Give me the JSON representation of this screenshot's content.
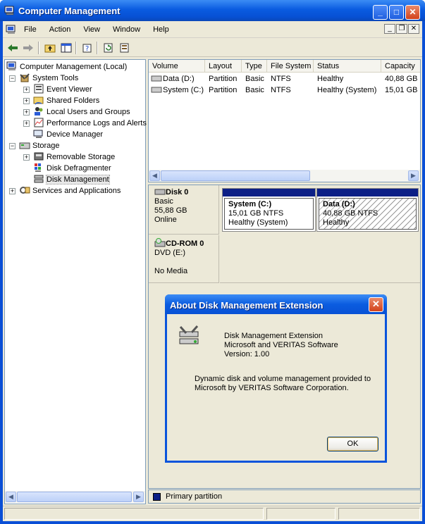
{
  "window": {
    "title": "Computer Management",
    "icon": "computer-management-icon"
  },
  "menu": {
    "items": [
      "File",
      "Action",
      "View",
      "Window",
      "Help"
    ]
  },
  "toolbar": {
    "buttons": [
      "back-arrow-icon",
      "forward-arrow-icon",
      "up-folder-icon",
      "show-hide-tree-icon",
      "help-icon",
      "refresh-icon",
      "properties-icon"
    ]
  },
  "tree": {
    "items": [
      {
        "label": "Computer Management (Local)",
        "icon": "computer-icon"
      },
      {
        "label": "System Tools",
        "icon": "tools-icon"
      },
      {
        "label": "Event Viewer",
        "icon": "event-viewer-icon"
      },
      {
        "label": "Shared Folders",
        "icon": "shared-folders-icon"
      },
      {
        "label": "Local Users and Groups",
        "icon": "users-icon"
      },
      {
        "label": "Performance Logs and Alerts",
        "icon": "performance-icon"
      },
      {
        "label": "Device Manager",
        "icon": "device-manager-icon"
      },
      {
        "label": "Storage",
        "icon": "storage-icon"
      },
      {
        "label": "Removable Storage",
        "icon": "removable-storage-icon"
      },
      {
        "label": "Disk Defragmenter",
        "icon": "defragmenter-icon"
      },
      {
        "label": "Disk Management",
        "icon": "disk-management-icon",
        "selected": true
      },
      {
        "label": "Services and Applications",
        "icon": "services-icon"
      }
    ]
  },
  "volume_list": {
    "columns": [
      "Volume",
      "Layout",
      "Type",
      "File System",
      "Status",
      "Capacity"
    ],
    "rows": [
      [
        "Data (D:)",
        "Partition",
        "Basic",
        "NTFS",
        "Healthy",
        "40,88 GB"
      ],
      [
        "System (C:)",
        "Partition",
        "Basic",
        "NTFS",
        "Healthy (System)",
        "15,01 GB"
      ]
    ]
  },
  "disks": {
    "disk0": {
      "name": "Disk 0",
      "type": "Basic",
      "size": "55,88 GB",
      "state": "Online"
    },
    "cdrom0": {
      "name": "CD-ROM 0",
      "type": "DVD (E:)",
      "state": "No Media"
    },
    "volumes": [
      {
        "name": "System  (C:)",
        "size": "15,01 GB NTFS",
        "status": "Healthy (System)"
      },
      {
        "name": "Data  (D:)",
        "size": "40,88 GB NTFS",
        "status": "Healthy"
      }
    ]
  },
  "legend": {
    "label": "Primary partition",
    "color": "#0c1f86"
  },
  "dialog": {
    "title": "About Disk Management Extension",
    "product": "Disk Management Extension",
    "vendor": "Microsoft and VERITAS Software",
    "version": "Version: 1.00",
    "description_line1": "Dynamic disk and volume management provided to",
    "description_line2": "Microsoft by VERITAS Software Corporation.",
    "ok_label": "OK"
  },
  "colors": {
    "titlebar": "#0a5be0",
    "frame": "#ece9d8",
    "partition_header": "#0c1f86"
  }
}
